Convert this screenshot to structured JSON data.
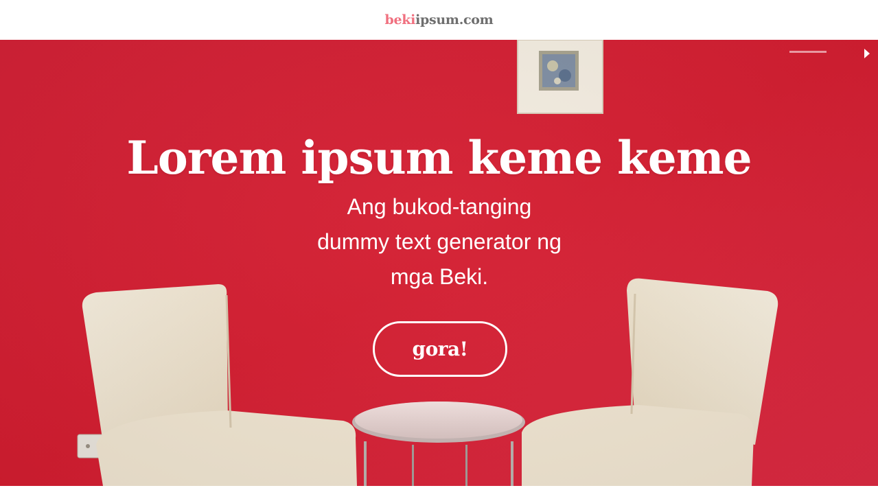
{
  "header": {
    "logo_brand": "beki",
    "logo_rest": "ipsum.com"
  },
  "hero": {
    "headline": "Lorem ipsum keme keme",
    "subhead_line1": "Ang bukod-tanging",
    "subhead_line2": "dummy text generator ng",
    "subhead_line3": "mga Beki.",
    "cta_label": "gora!"
  },
  "colors": {
    "brand_pink": "#f0707f",
    "logo_gray": "#6e6e6e",
    "wall_red": "#d21c31",
    "chair_cream": "#f3ead9",
    "text_white": "#ffffff"
  },
  "icons": {
    "next": "caret-right-icon"
  }
}
